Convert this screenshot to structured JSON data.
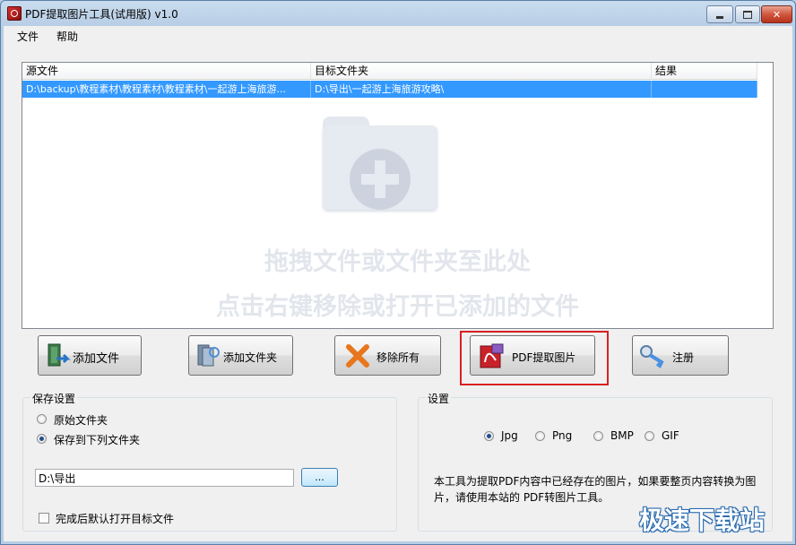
{
  "window": {
    "title": "PDF提取图片工具(试用版) v1.0",
    "accent_color": "#3399ff"
  },
  "menu": [
    "文件",
    "帮助"
  ],
  "file_list": {
    "columns": [
      "源文件",
      "目标文件夹",
      "结果"
    ],
    "rows": [
      [
        "D:\\backup\\教程素材\\教程素材\\教程素材\\一起游上海旅游...",
        "D:\\导出\\一起游上海旅游攻略\\",
        ""
      ]
    ],
    "hints": [
      "拖拽文件或文件夹至此处",
      "点击右键移除或打开已添加的文件"
    ],
    "drop_icon": "folder-plus-icon"
  },
  "buttons": {
    "add_file": "添加文件",
    "add_folder": "添加文件夹",
    "remove_all": "移除所有",
    "extract": "PDF提取图片",
    "register": "注册"
  },
  "save_settings": {
    "title": "保存设置",
    "option_original": "原始文件夹",
    "option_custom": "保存到下列文件夹",
    "selected": "保存到下列文件夹",
    "path_value": "D:\\导出",
    "browse_label": "...",
    "open_after_label": "完成后默认打开目标文件",
    "open_after_checked": false
  },
  "settings": {
    "title": "设置",
    "formats": [
      "Jpg",
      "Png",
      "BMP",
      "GIF"
    ],
    "selected_format": "Jpg",
    "description": "本工具为提取PDF内容中已经存在的图片，如果要整页内容转换为图片，请使用本站的 PDF转图片工具。"
  },
  "watermark": "极速下载站"
}
